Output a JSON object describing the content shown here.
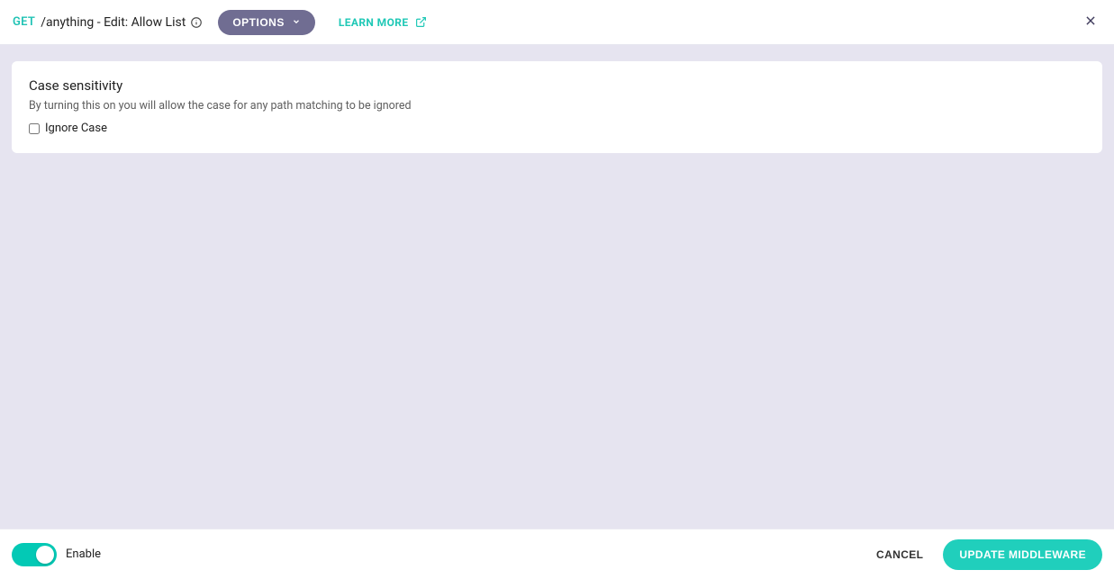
{
  "header": {
    "method": "GET",
    "title": "/anything - Edit: Allow List",
    "options_label": "OPTIONS",
    "learn_more_label": "LEARN MORE"
  },
  "card": {
    "title": "Case sensitivity",
    "description": "By turning this on you will allow the case for any path matching to be ignored",
    "checkbox_label": "Ignore Case",
    "checkbox_checked": false
  },
  "footer": {
    "toggle_label": "Enable",
    "toggle_on": true,
    "cancel_label": "CANCEL",
    "update_label": "UPDATE MIDDLEWARE"
  }
}
